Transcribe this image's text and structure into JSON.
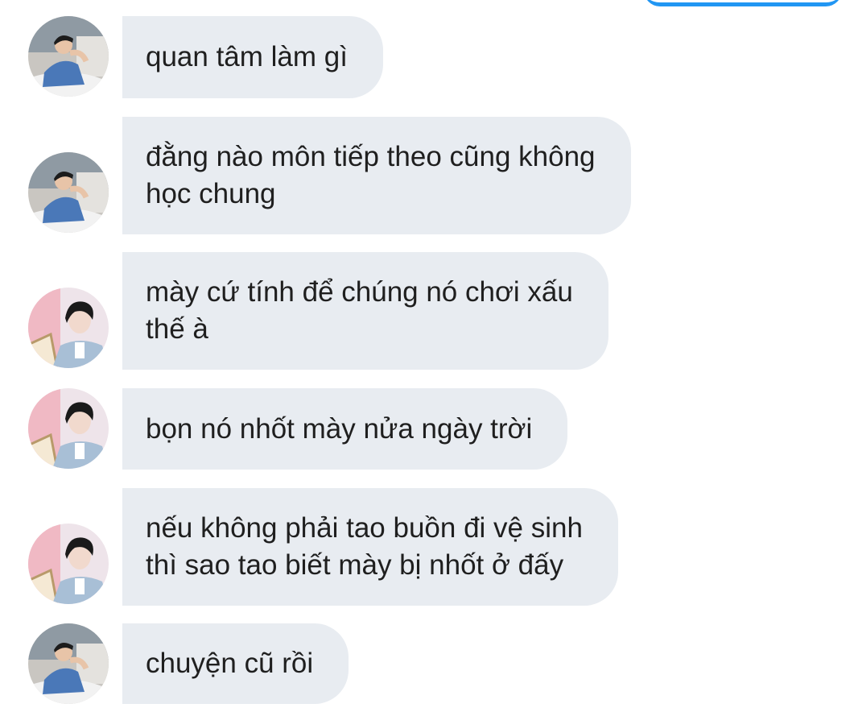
{
  "colors": {
    "bubble_bg": "#e8ecf1",
    "text": "#1f1f1f",
    "sent_accent": "#2196f3",
    "background": "#ffffff"
  },
  "messages": [
    {
      "avatar": "avatar-a",
      "lines": [
        "quan tâm làm gì"
      ]
    },
    {
      "avatar": "avatar-a",
      "lines": [
        "đằng nào môn tiếp theo cũng không",
        "học chung"
      ]
    },
    {
      "avatar": "avatar-b",
      "lines": [
        "mày cứ tính để chúng nó chơi xấu",
        "thế à"
      ]
    },
    {
      "avatar": "avatar-b",
      "lines": [
        "bọn nó nhốt mày nửa ngày trời"
      ]
    },
    {
      "avatar": "avatar-b",
      "lines": [
        "nếu không phải tao buồn đi vệ sinh",
        "thì sao tao biết mày bị nhốt ở đấy"
      ]
    },
    {
      "avatar": "avatar-a",
      "lines": [
        "chuyện cũ rồi"
      ]
    }
  ]
}
